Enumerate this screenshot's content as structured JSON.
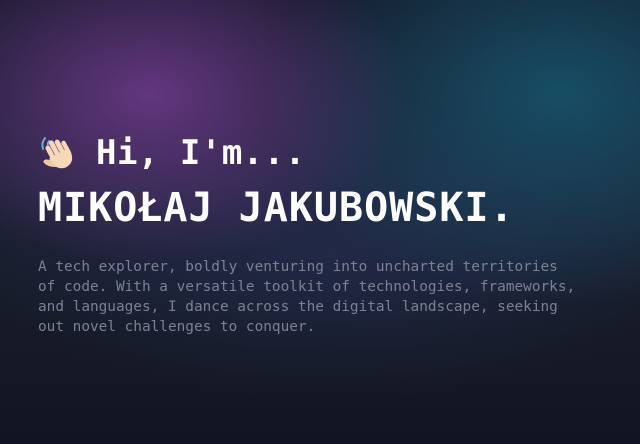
{
  "hero": {
    "wave_icon": "waving-hand-icon",
    "greeting": "Hi, I'm...",
    "name": "MIKOŁAJ JAKUBOWSKI.",
    "bio": "A tech explorer, boldly venturing into uncharted territories\nof code. With a versatile toolkit of technologies, frameworks,\nand languages, I dance across the digital landscape, seeking\nout novel challenges to conquer."
  },
  "colors": {
    "background": "#171a26",
    "purple_glow": "#703a8c",
    "teal_glow": "#16566e",
    "heading_text": "#ffffff",
    "body_text": "#7d8095"
  }
}
